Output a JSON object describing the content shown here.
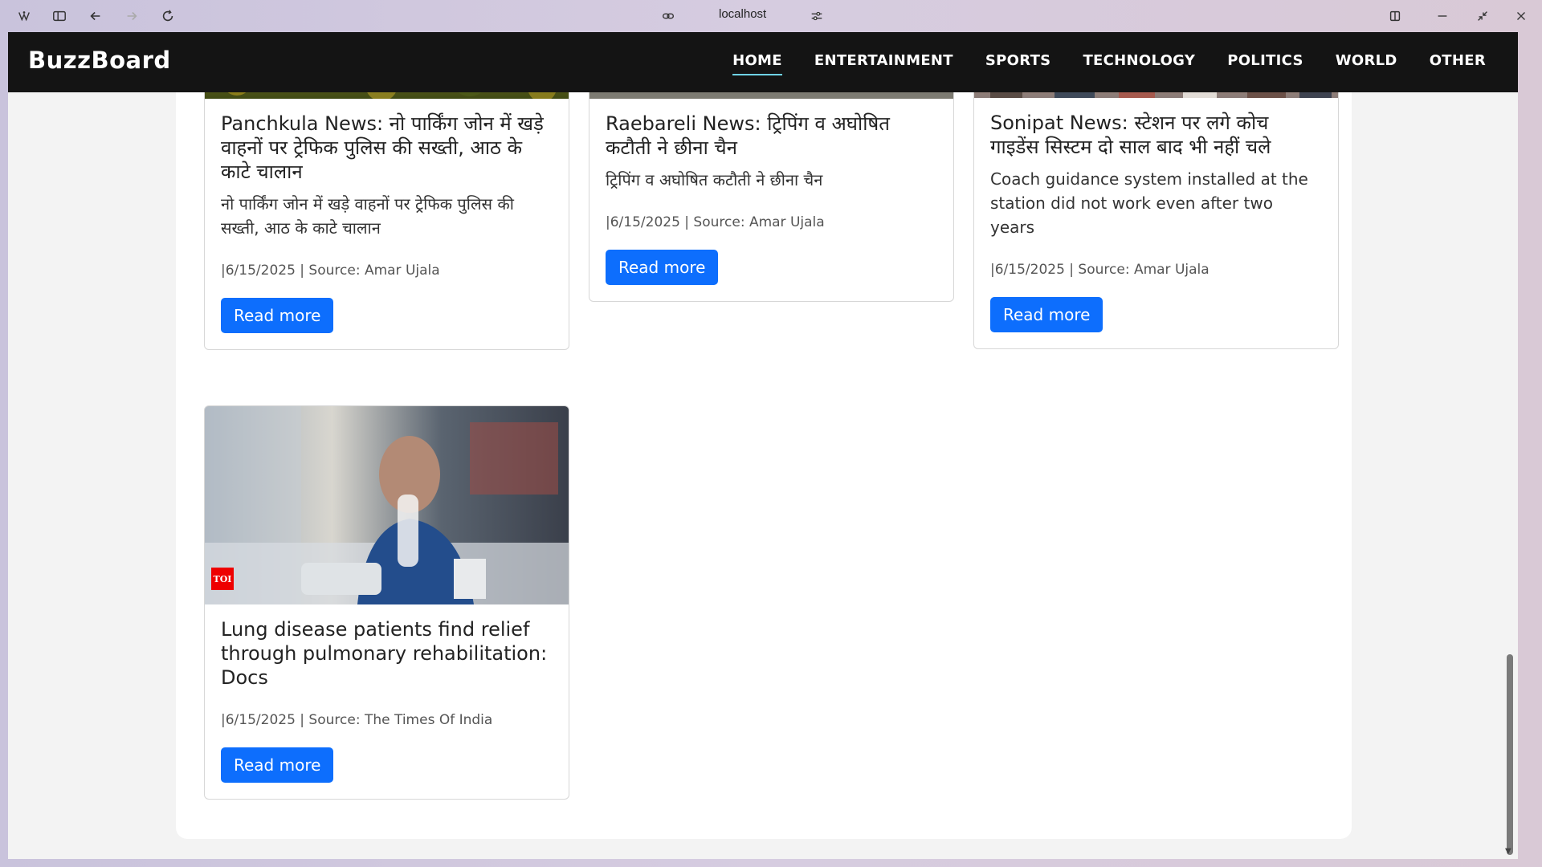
{
  "browser": {
    "url": "localhost",
    "icons": [
      "logo-icon",
      "sidebar-icon",
      "back-icon",
      "forward-icon",
      "reload-icon",
      "link-icon",
      "settings-icon",
      "split-view-icon",
      "minimize-icon",
      "restore-icon",
      "close-icon"
    ]
  },
  "site": {
    "brand": "BuzzBoard",
    "nav": [
      {
        "label": "HOME",
        "active": true
      },
      {
        "label": "ENTERTAINMENT",
        "active": false
      },
      {
        "label": "SPORTS",
        "active": false
      },
      {
        "label": "TECHNOLOGY",
        "active": false
      },
      {
        "label": "POLITICS",
        "active": false
      },
      {
        "label": "WORLD",
        "active": false
      },
      {
        "label": "OTHER",
        "active": false
      }
    ]
  },
  "cards": [
    {
      "title": "Panchkula News: नो पार्किंग जोन में खड़े वाहनों पर ट्रेफिक पुलिस की सख्ती, आठ के काटे चालान",
      "description": "नो पार्किंग जोन में खड़े वाहनों पर ट्रेफिक पुलिस की सख्ती, आठ के काटे चालान",
      "meta": "|6/15/2025 | Source: Amar Ujala",
      "button": "Read more"
    },
    {
      "title": "Raebareli News: ट्रिपिंग व अघोषित कटौती ने छीना चैन",
      "description": "ट्रिपिंग व अघोषित कटौती ने छीना चैन",
      "meta": "|6/15/2025 | Source: Amar Ujala",
      "button": "Read more"
    },
    {
      "title": "Sonipat News: स्टेशन पर लगे कोच गाइडेंस सिस्टम दो साल बाद भी नहीं चले",
      "description": "Coach guidance system installed at the station did not work even after two years",
      "meta": "|6/15/2025 | Source: Amar Ujala",
      "button": "Read more"
    },
    {
      "title": "Lung disease patients find relief through pulmonary rehabilitation: Docs",
      "description": "",
      "meta": "|6/15/2025 | Source: The Times Of India",
      "button": "Read more",
      "badge": "TOI"
    }
  ]
}
